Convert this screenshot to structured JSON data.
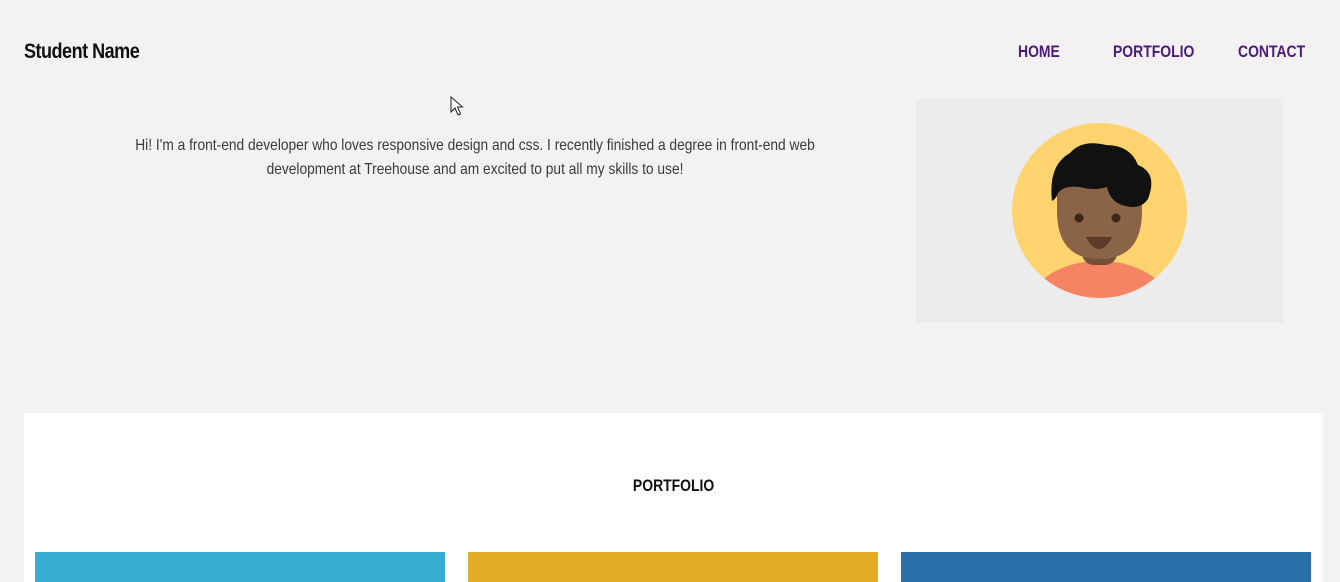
{
  "header": {
    "brand": "Student Name",
    "nav": [
      "HOME",
      "PORTFOLIO",
      "CONTACT"
    ]
  },
  "intro": {
    "text": "Hi! I'm a front-end developer who loves responsive design and css. I recently finished a degree in front-end web development at Treehouse and am excited to put all my skills to use!"
  },
  "avatar": {
    "icon": "person-avatar-icon",
    "colors": {
      "panel": "#ececec",
      "circle": "#ffd36e",
      "skin": "#8b6347",
      "neck": "#735139",
      "hair": "#111111",
      "shirt": "#f58464"
    }
  },
  "portfolio": {
    "title": "PORTFOLIO",
    "tile_colors": [
      "#36acd0",
      "#e2ac26",
      "#2870a8"
    ]
  },
  "colors": {
    "page_background": "#f3f1f2",
    "nav_link": "#4b1a7a",
    "section_background": "#ffffff"
  }
}
